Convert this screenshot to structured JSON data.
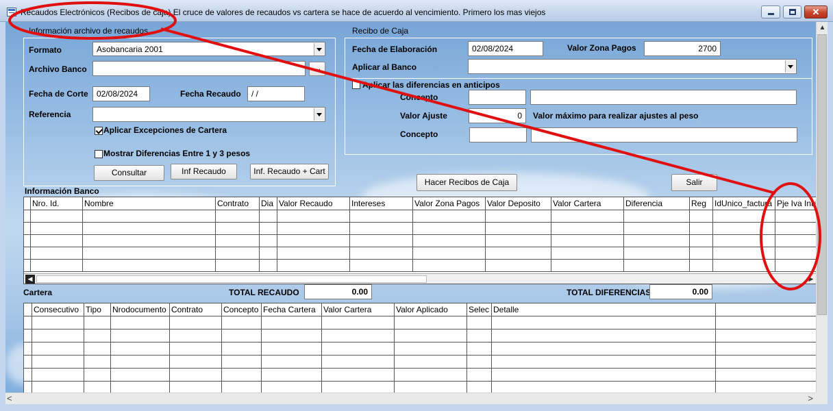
{
  "window": {
    "title": "Recaudos Electrónicos (Recibos de caja) El cruce de valores de recaudos vs cartera se hace de acuerdo al vencimiento. Primero los mas viejos",
    "minimize": "_",
    "maximize": "□",
    "close": "✕"
  },
  "archivo": {
    "group_title": "Información archivo de recaudos",
    "formato_label": "Formato",
    "formato_value": "Asobancaria 2001",
    "archivo_label": "Archivo Banco",
    "archivo_value": "",
    "browse": "...",
    "fecha_corte_label": "Fecha de Corte",
    "fecha_corte_value": "02/08/2024",
    "fecha_recaudo_label": "Fecha Recaudo",
    "fecha_recaudo_value": "/ /",
    "referencia_label": "Referencia",
    "referencia_value": "",
    "excepciones_label": "Aplicar Excepciones de Cartera",
    "excepciones_checked": true,
    "diferencias_label": "Mostrar Diferencias Entre 1 y 3 pesos",
    "diferencias_checked": false,
    "consultar": "Consultar",
    "inf_recaudo": "Inf Recaudo",
    "inf_recaudo_cart": "Inf. Recaudo + Cart"
  },
  "recibo": {
    "group_title": "Recibo de Caja",
    "fecha_elab_label": "Fecha de Elaboración",
    "fecha_elab_value": "02/08/2024",
    "valor_zona_label": "Valor Zona Pagos",
    "valor_zona_value": "2700",
    "aplicar_banco_label": "Aplicar al Banco",
    "aplicar_banco_value": "",
    "anticipos_label": "Aplicar las diferencias en anticipos",
    "anticipos_checked": false,
    "concepto1_label": "Concepto",
    "concepto1_code": "",
    "concepto1_desc": "",
    "valor_ajuste_label": "Valor Ajuste",
    "valor_ajuste_value": "0",
    "valor_max_text": "Valor máximo para realizar ajustes al peso",
    "concepto2_label": "Concepto",
    "concepto2_code": "",
    "concepto2_desc": "",
    "hacer_recibos": "Hacer Recibos de Caja",
    "salir": "Salir"
  },
  "banco": {
    "title": "Información Banco",
    "columns": [
      "Nro. Id.",
      "Nombre",
      "Contrato",
      "Dia",
      "Valor Recaudo",
      "Intereses",
      "Valor Zona Pagos",
      "Valor Deposito",
      "Valor Cartera",
      "Diferencia",
      "Reg",
      "IdUnico_factura",
      "Pje Iva Intere"
    ],
    "scroll_left": "◀",
    "scroll_right": "▶"
  },
  "totales": {
    "cartera_title": "Cartera",
    "total_recaudo_label": "TOTAL RECAUDO",
    "total_recaudo_value": "0.00",
    "total_dif_label": "TOTAL DIFERENCIAS",
    "total_dif_value": "0.00"
  },
  "cartera": {
    "columns": [
      "Consecutivo",
      "Tipo",
      "Nrodocumento",
      "Contrato",
      "Concepto",
      "Fecha Cartera",
      "Valor Cartera",
      "Valor Aplicado",
      "Selec",
      "Detalle"
    ]
  },
  "scroll": {
    "up": "▲",
    "left": "<",
    "right": ">"
  },
  "colors": {
    "annotation": "#e01010",
    "sky": "#9cc0e5",
    "titlebar": "#c4d6ec"
  }
}
